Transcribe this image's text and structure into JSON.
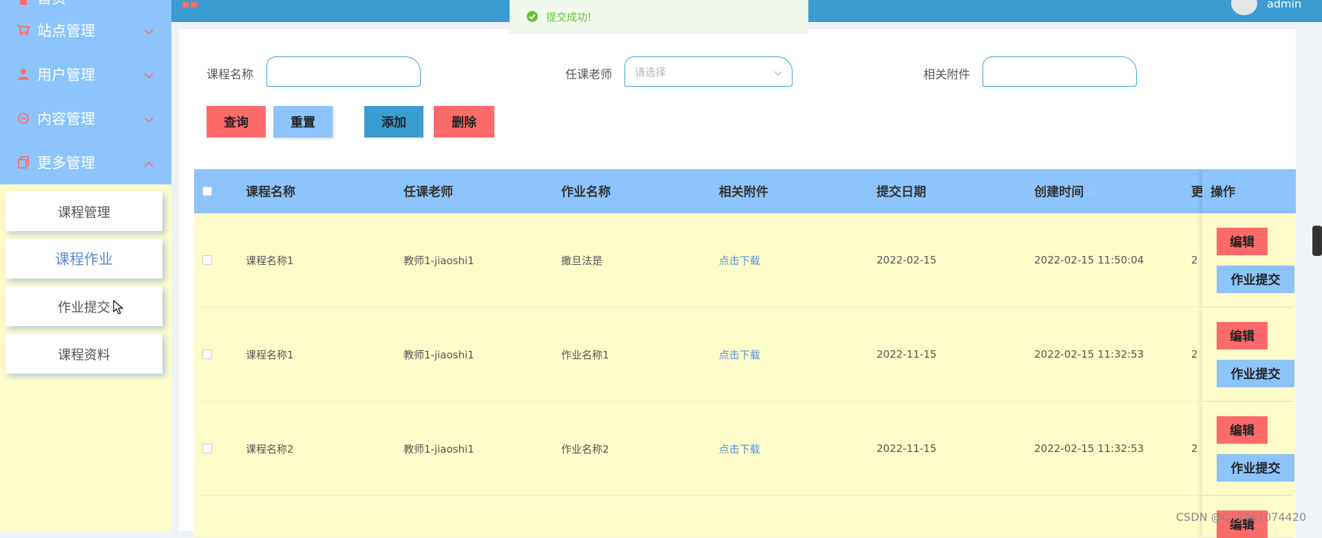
{
  "sidebar": {
    "menu": [
      {
        "label": "首页",
        "icon": "home-icon"
      },
      {
        "label": "站点管理",
        "icon": "cart-icon"
      },
      {
        "label": "用户管理",
        "icon": "user-icon"
      },
      {
        "label": "内容管理",
        "icon": "chat-icon"
      },
      {
        "label": "更多管理",
        "icon": "copy-icon"
      }
    ],
    "submenu": [
      "课程管理",
      "课程作业",
      "作业提交",
      "课程资料"
    ],
    "active_submenu": "课程作业"
  },
  "topbar": {
    "user": "admin"
  },
  "toast": {
    "message": "提交成功!"
  },
  "search": {
    "course_label": "课程名称",
    "course_value": "",
    "teacher_label": "任课老师",
    "teacher_placeholder": "请选择",
    "attachment_label": "相关附件",
    "attachment_value": ""
  },
  "buttons": {
    "query": "查询",
    "reset": "重置",
    "add": "添加",
    "delete": "删除"
  },
  "table": {
    "headers": [
      "课程名称",
      "任课老师",
      "作业名称",
      "相关附件",
      "提交日期",
      "创建时间",
      "更",
      "操作"
    ],
    "rows": [
      {
        "course": "课程名称1",
        "teacher": "教师1-jiaoshi1",
        "homework": "撒旦法是",
        "attachment": "点击下载",
        "submit_date": "2022-02-15",
        "created": "2022-02-15 11:50:04",
        "extra": "2"
      },
      {
        "course": "课程名称1",
        "teacher": "教师1-jiaoshi1",
        "homework": "作业名称1",
        "attachment": "点击下载",
        "submit_date": "2022-11-15",
        "created": "2022-02-15 11:32:53",
        "extra": "2"
      },
      {
        "course": "课程名称2",
        "teacher": "教师1-jiaoshi1",
        "homework": "作业名称2",
        "attachment": "点击下载",
        "submit_date": "2022-11-15",
        "created": "2022-02-15 11:32:53",
        "extra": "2"
      }
    ],
    "actions": {
      "edit": "编辑",
      "submit": "作业提交"
    }
  },
  "watermark": "CSDN @Q_3461074420",
  "colors": {
    "sidebar_menu": "#8cc4fb",
    "sidebar_bg": "#fefccb",
    "topbar": "#3a9cd0",
    "danger": "#fd6a6a",
    "success": "#67c23a"
  }
}
